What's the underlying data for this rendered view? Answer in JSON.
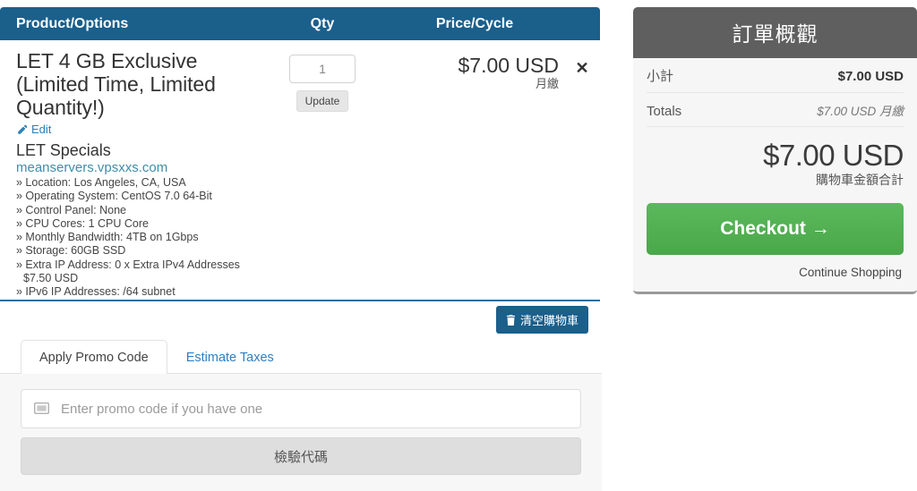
{
  "cart_table": {
    "columns": {
      "product": "Product/Options",
      "qty": "Qty",
      "price": "Price/Cycle"
    },
    "item": {
      "title": "LET 4 GB Exclusive (Limited Time, Limited Quantity!)",
      "edit_label": "Edit",
      "edit_icon": "pencil-icon",
      "config_group": "LET Specials",
      "domain": "meanservers.vpsxxs.com",
      "options": [
        "» Location: Los Angeles, CA, USA",
        "» Operating System: CentOS 7.0 64-Bit",
        "» Control Panel: None",
        "» CPU Cores: 1 CPU Core",
        "» Monthly Bandwidth: 4TB on 1Gbps",
        "» Storage: 60GB SSD",
        "» Extra IP Address: 0 x Extra IPv4 Addresses $7.50 USD",
        "» IPv6 IP Addresses: /64 subnet"
      ],
      "qty_value": "1",
      "update_label": "Update",
      "price_amount": "$7.00 USD",
      "price_cycle": "月繳",
      "remove_icon": "close-icon",
      "remove_label": "✕"
    }
  },
  "clear_cart": {
    "label": "清空購物車",
    "icon": "trash-icon"
  },
  "promo": {
    "tabs": [
      {
        "label": "Apply Promo Code",
        "active": true
      },
      {
        "label": "Estimate Taxes",
        "active": false
      }
    ],
    "input_placeholder": "Enter promo code if you have one",
    "input_value": "",
    "input_icon": "ticket-icon",
    "validate_label": "檢驗代碼"
  },
  "order_summary": {
    "title": "訂單概觀",
    "rows": [
      {
        "label": "小計",
        "value": "$7.00 USD"
      },
      {
        "label": "Totals",
        "value": "$7.00 USD 月繳"
      }
    ],
    "grand_total_amount": "$7.00 USD",
    "grand_total_label": "購物車金額合計",
    "checkout_label": "Checkout →",
    "continue_shopping_label": "Continue Shopping"
  },
  "colors": {
    "table_header_bg": "#1b5f8b",
    "summary_header_bg": "#5f5f5f",
    "checkout_green": "#5cb85c",
    "link_blue": "#2b7fb8",
    "row_divider_blue": "#2b6f9e"
  }
}
